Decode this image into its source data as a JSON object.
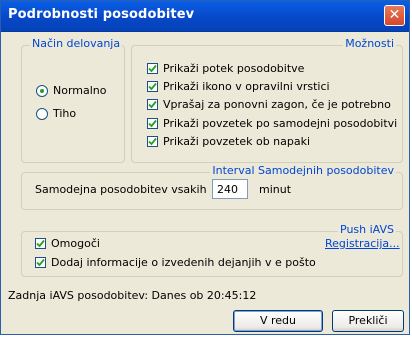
{
  "window": {
    "title": "Podrobnosti posodobitev",
    "close_glyph": "✕"
  },
  "mode_group": {
    "legend": "Način delovanja",
    "options": [
      {
        "label": "Normalno",
        "selected": true
      },
      {
        "label": "Tiho",
        "selected": false
      }
    ]
  },
  "options_group": {
    "legend": "Možnosti",
    "items": [
      {
        "label": "Prikaži potek posodobitve",
        "checked": true
      },
      {
        "label": "Prikaži ikono v opravilni vrstici",
        "checked": true
      },
      {
        "label": "Vprašaj za ponovni zagon, če je potrebno",
        "checked": true
      },
      {
        "label": "Prikaži povzetek po samodejni posodobitvi",
        "checked": true
      },
      {
        "label": "Prikaži povzetek ob napaki",
        "checked": true
      }
    ]
  },
  "interval_group": {
    "legend": "Interval Samodejnih posodobitev",
    "label": "Samodejna posodobitev vsakih",
    "value": "240",
    "unit": "minut"
  },
  "push_group": {
    "legend": "Push iAVS",
    "link": "Registracija...",
    "items": [
      {
        "label": "Omogoči",
        "checked": true
      },
      {
        "label": "Dodaj informacije o izvedenih dejanjih v e pošto",
        "checked": true
      }
    ]
  },
  "status": "Zadnja iAVS posodobitev: Danes ob 20:45:12",
  "buttons": {
    "ok": "V redu",
    "cancel": "Prekliči"
  },
  "colors": {
    "titlebar": "#0748c9",
    "group_legend": "#0046d5",
    "dialog_bg": "#ece9d8",
    "close_button": "#d6472b"
  }
}
